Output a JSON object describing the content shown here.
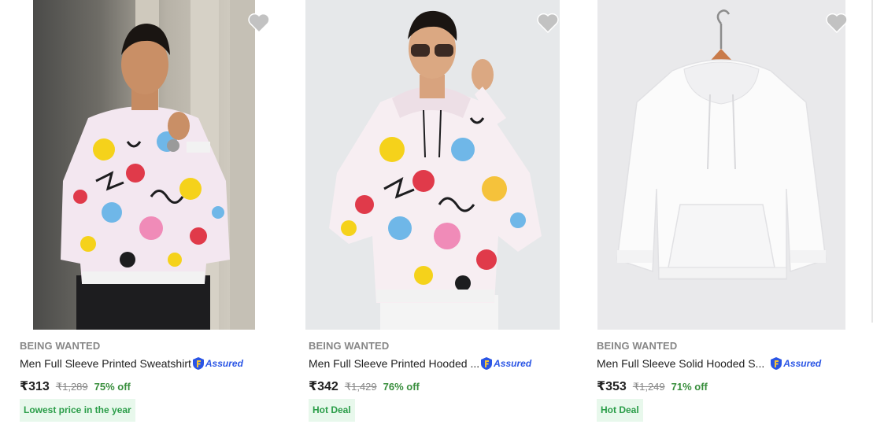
{
  "products": [
    {
      "brand": "BEING WANTED",
      "title": "Men Full Sleeve Printed Sweatshirt",
      "assured": "Assured",
      "price": "₹313",
      "mrp": "₹1,289",
      "discount": "75% off",
      "badge": "Lowest price in the year",
      "image": "man-printed-sweatshirt",
      "wishlist_icon": "heart-icon"
    },
    {
      "brand": "BEING WANTED",
      "title": "Men Full Sleeve Printed Hooded ...",
      "assured": "Assured",
      "price": "₹342",
      "mrp": "₹1,429",
      "discount": "76% off",
      "badge": "Hot Deal",
      "image": "man-printed-hoodie-sunglasses",
      "wishlist_icon": "heart-icon"
    },
    {
      "brand": "BEING WANTED",
      "title": "Men Full Sleeve Solid Hooded S...",
      "assured": "Assured",
      "price": "₹353",
      "mrp": "₹1,249",
      "discount": "71% off",
      "badge": "Hot Deal",
      "image": "white-hoodie-on-hanger",
      "wishlist_icon": "heart-icon"
    }
  ],
  "colors": {
    "brand_text": "#878787",
    "discount_green": "#388e3c",
    "badge_bg": "#e8f8ec",
    "badge_text": "#2a9d48",
    "assured_blue": "#2a55e5",
    "heart_grey": "#c2c2c2"
  }
}
